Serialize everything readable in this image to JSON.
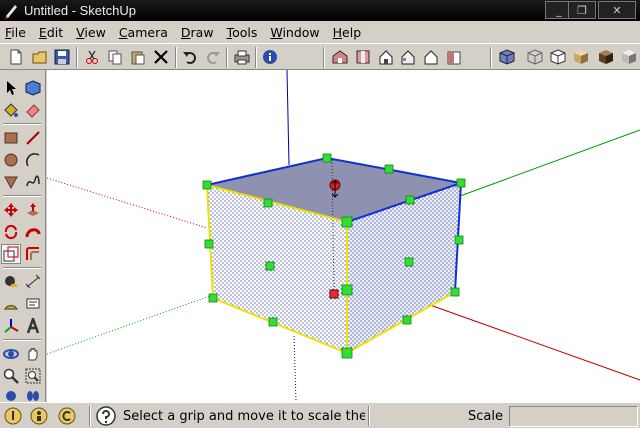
{
  "window": {
    "title": "Untitled - SketchUp"
  },
  "window_controls": {
    "minimize": "_",
    "restore": "❐",
    "close": "✕"
  },
  "menu": [
    {
      "label": "File",
      "accel": "F",
      "rest": "ile"
    },
    {
      "label": "Edit",
      "accel": "E",
      "rest": "dit"
    },
    {
      "label": "View",
      "accel": "V",
      "rest": "iew"
    },
    {
      "label": "Camera",
      "accel": "C",
      "rest": "amera"
    },
    {
      "label": "Draw",
      "accel": "D",
      "rest": "raw"
    },
    {
      "label": "Tools",
      "accel": "T",
      "rest": "ools"
    },
    {
      "label": "Window",
      "accel": "W",
      "rest": "indow"
    },
    {
      "label": "Help",
      "accel": "H",
      "rest": "elp"
    }
  ],
  "toolbar_icons": [
    "new-icon",
    "open-icon",
    "save-icon",
    "cut-icon",
    "copy-icon",
    "paste-icon",
    "erase-icon",
    "undo-icon",
    "redo-icon",
    "print-icon",
    "model-info-icon",
    "iso-view-icon",
    "top-view-icon",
    "front-view-icon",
    "right-view-icon",
    "back-view-icon",
    "left-view-icon",
    "xray-style-icon",
    "wireframe-style-icon",
    "hidden-line-style-icon",
    "shaded-style-icon",
    "shaded-textures-style-icon",
    "monochrome-style-icon"
  ],
  "left_tools": [
    "select-tool",
    "component-tool",
    "paint-bucket-tool",
    "eraser-tool",
    "rectangle-tool",
    "line-tool",
    "circle-tool",
    "arc-tool",
    "polygon-tool",
    "freehand-tool",
    "move-tool",
    "push-pull-tool",
    "rotate-tool",
    "follow-me-tool",
    "scale-tool",
    "offset-tool",
    "tape-measure-tool",
    "dimension-tool",
    "protractor-tool",
    "text-tool",
    "axes-tool",
    "3d-text-tool",
    "orbit-tool",
    "pan-tool",
    "zoom-tool",
    "zoom-window-tool",
    "walk-tool",
    "look-around-tool"
  ],
  "colors": {
    "x_axis": "#c00000",
    "y_axis": "#00a000",
    "z_axis": "#0000c0",
    "selection": "#f0e000",
    "grip": "#33dd33",
    "top_face": "#8e92b0"
  },
  "status": {
    "message": "Select a grip and move it to scale the c",
    "vcb_label": "Scale",
    "vcb_value": ""
  }
}
